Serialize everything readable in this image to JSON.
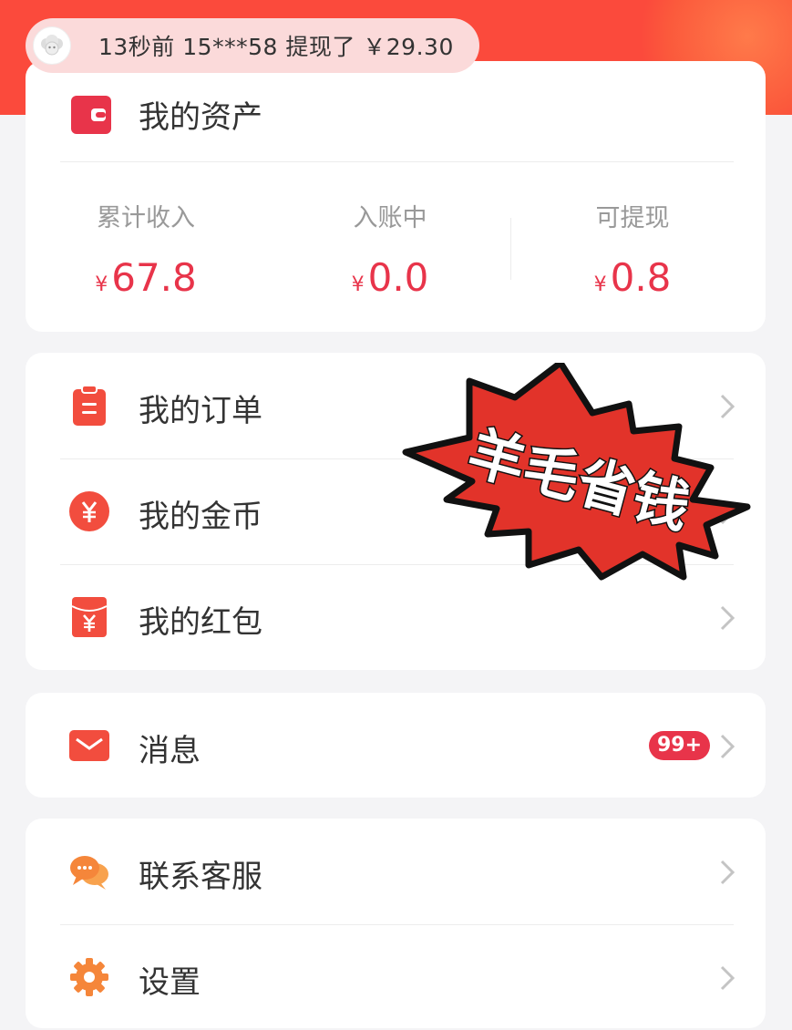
{
  "notice": {
    "text": "13秒前 15***58 提现了 ￥29.30"
  },
  "assets": {
    "title": "我的资产",
    "stats": [
      {
        "label": "累计收入",
        "currency": "¥",
        "value": "67.8"
      },
      {
        "label": "入账中",
        "currency": "¥",
        "value": "0.0"
      },
      {
        "label": "可提现",
        "currency": "¥",
        "value": "0.8"
      }
    ]
  },
  "menu": {
    "orders": "我的订单",
    "coins": "我的金币",
    "red_packets": "我的红包",
    "messages": "消息",
    "messages_badge": "99+",
    "support": "联系客服",
    "settings": "设置"
  },
  "sticker": {
    "text": "羊毛省钱"
  },
  "colors": {
    "banner": "#fb4a3c",
    "accent": "#e8344a",
    "icon_red": "#f24d3e",
    "icon_orange": "#f5863a"
  }
}
